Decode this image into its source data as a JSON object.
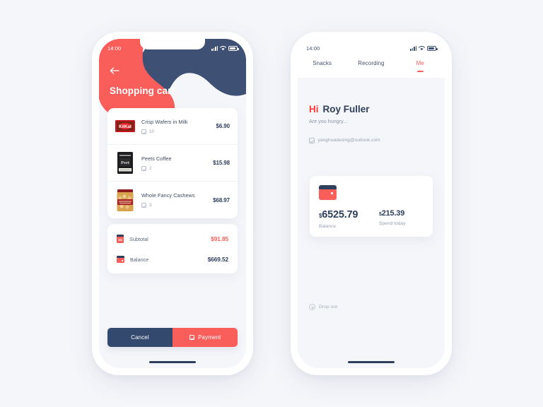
{
  "colors": {
    "red": "#fa5e5b",
    "red_bright": "#fa3c3c",
    "navy": "#3e5175",
    "navy_dark": "#33496e",
    "text_navy": "#2e3f5c",
    "bg": "#f5f6fa",
    "card": "#ffffff",
    "muted": "#99a0b0"
  },
  "cart_screen": {
    "status_bar": {
      "time": "14:00",
      "signal_icon": "signal-bars-icon",
      "wifi_icon": "wifi-icon",
      "battery_icon": "battery-icon"
    },
    "back_icon": "back-arrow-icon",
    "title": "Shopping cart",
    "items": [
      {
        "name": "Crisp Wafers in Milk",
        "qty": "10",
        "price": "$6.90",
        "thumb": "kitkat-wafer-thumb"
      },
      {
        "name": "Peets Coffee",
        "qty": "2",
        "price": "$15.98",
        "thumb": "coffee-bag-thumb"
      },
      {
        "name": "Whole Fancy Cashews",
        "qty": "3",
        "price": "$68.97",
        "thumb": "cashew-jar-thumb"
      }
    ],
    "summary": [
      {
        "icon": "receipt-icon",
        "label": "Subtotal",
        "value": "$91.85",
        "accent": "red"
      },
      {
        "icon": "wallet-icon",
        "label": "Balance",
        "value": "$669.52",
        "accent": "navy"
      }
    ],
    "buttons": {
      "cancel_label": "Cancel",
      "payment_label": "Payment",
      "payment_icon": "checkbox-check-icon"
    }
  },
  "profile_screen": {
    "status_bar": {
      "time": "14:00",
      "signal_icon": "signal-bars-icon",
      "wifi_icon": "wifi-icon",
      "battery_icon": "battery-icon"
    },
    "tabs": [
      {
        "label": "Snacks",
        "active": false
      },
      {
        "label": "Recording",
        "active": false
      },
      {
        "label": "Me",
        "active": true
      }
    ],
    "greeting_prefix": "Hi",
    "user_name": "Roy Fuller",
    "subtitle": "Are you hungry...",
    "email": "yanghuadesing@outlook.com",
    "email_icon": "checkbox-check-icon",
    "wallet": {
      "icon": "wallet-icon",
      "balance": {
        "currency": "$",
        "amount": "6525.79",
        "label": "Balance"
      },
      "spend": {
        "currency": "$",
        "amount": "215.39",
        "label": "Spend today"
      }
    },
    "drop_out": {
      "icon": "close-circle-icon",
      "label": "Drop out"
    }
  }
}
